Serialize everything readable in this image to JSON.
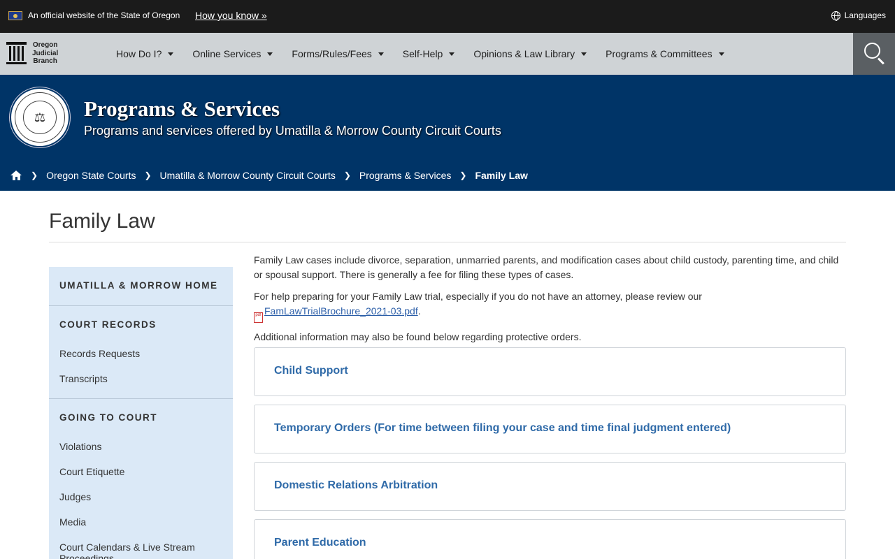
{
  "topbar": {
    "official_text": "An official website of the State of Oregon",
    "how_you_know": "How you know »",
    "languages": "Languages"
  },
  "logo": {
    "line1": "Oregon",
    "line2": "Judicial",
    "line3": "Branch"
  },
  "nav": {
    "items": [
      {
        "label": "How Do I?"
      },
      {
        "label": "Online Services"
      },
      {
        "label": "Forms/Rules/Fees"
      },
      {
        "label": "Self-Help"
      },
      {
        "label": "Opinions & Law Library"
      },
      {
        "label": "Programs & Committees"
      }
    ]
  },
  "hero": {
    "title": "Programs & Services",
    "subtitle": "Programs and services offered by Umatilla & Morrow County Circuit Courts"
  },
  "breadcrumb": {
    "items": [
      "Oregon State Courts",
      "Umatilla & Morrow County Circuit Courts",
      "Programs & Services"
    ],
    "current": "Family Law"
  },
  "page": {
    "title": "Family Law"
  },
  "sidebar": {
    "home": "UMATILLA & MORROW HOME",
    "court_records": "COURT RECORDS",
    "records_links": [
      "Records Requests",
      "Transcripts"
    ],
    "going_to_court": "GOING TO COURT",
    "court_links": [
      "Violations",
      "Court Etiquette",
      "Judges",
      "Media",
      "Court Calendars & Live Stream Proceedings"
    ]
  },
  "content": {
    "p1": "Family Law cases include divorce, separation, unmarried parents, and modification cases about child custody, parenting time, and child or spousal support. There is generally a fee for filing these types of cases.",
    "p2": "For help preparing for your Family Law trial, especially if you do not have an attorney, please review our",
    "pdf_link": "FamLawTrialBrochure_2021-03.pdf",
    "pdf_badge": "pdf",
    "p3": "Additional information may also be found below regarding protective orders."
  },
  "accordion": [
    "Child Support",
    "Temporary Orders (For time between filing your case and time final judgment entered)",
    "Domestic Relations Arbitration",
    "Parent Education"
  ],
  "icons": {
    "flag": "oregon-flag-icon",
    "globe": "globe-icon",
    "search": "search-icon",
    "home": "home-icon",
    "caret": "caret-down-icon",
    "pdf": "pdf-icon"
  },
  "colors": {
    "topbar": "#1b1b1b",
    "navbar": "#cfd3d6",
    "hero": "#003467",
    "sidebar": "#dbe9f7",
    "accordion_title": "#2f6aa8"
  }
}
